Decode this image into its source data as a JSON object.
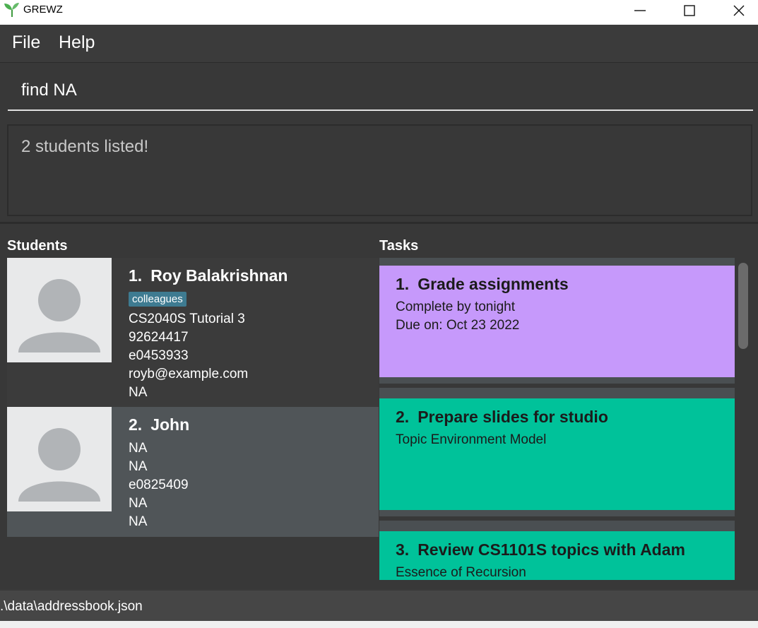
{
  "window": {
    "title": "GREWZ"
  },
  "menu": {
    "file": "File",
    "help": "Help"
  },
  "command": {
    "value": "find NA"
  },
  "result": {
    "text": "2 students listed!"
  },
  "panels": {
    "students_title": "Students",
    "tasks_title": "Tasks"
  },
  "students": [
    {
      "index": "1.",
      "name": "Roy Balakrishnan",
      "tag": "colleagues",
      "lines": [
        "CS2040S Tutorial 3",
        "92624417",
        "e0453933",
        "royb@example.com",
        "NA"
      ]
    },
    {
      "index": "2.",
      "name": "John",
      "lines": [
        "NA",
        "NA",
        "e0825409",
        "NA",
        "NA"
      ]
    }
  ],
  "tasks": [
    {
      "index": "1.",
      "title": "Grade assignments",
      "lines": [
        "Complete by tonight",
        "Due on: Oct 23 2022"
      ],
      "color": "#c699fb"
    },
    {
      "index": "2.",
      "title": "Prepare slides for studio",
      "lines": [
        "Topic Environment Model"
      ],
      "color": "#00c29a"
    },
    {
      "index": "3.",
      "title": "Review CS1101S topics with Adam",
      "lines": [
        "Essence of Recursion"
      ],
      "color": "#00c29a"
    }
  ],
  "status": {
    "path": ".\\data\\addressbook.json"
  }
}
